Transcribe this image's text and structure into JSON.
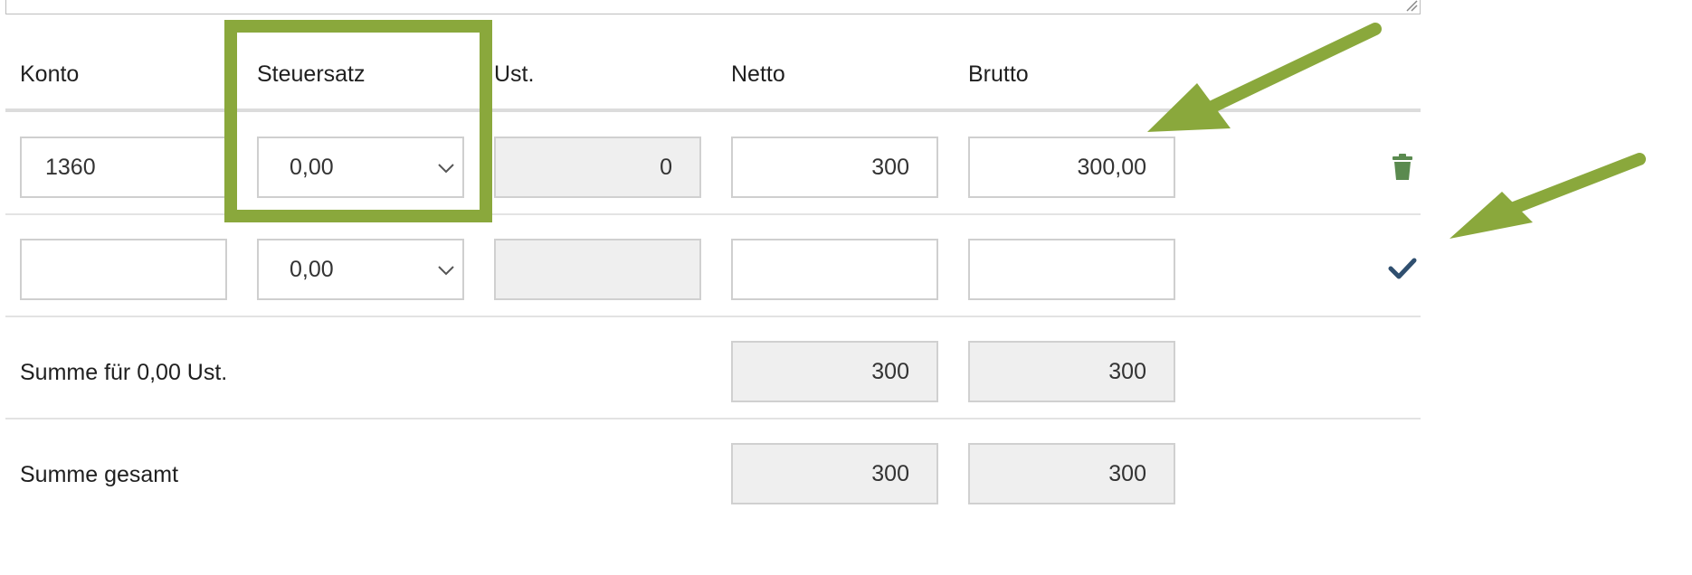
{
  "table": {
    "headers": {
      "konto": "Konto",
      "steuersatz": "Steuersatz",
      "ust": "Ust.",
      "netto": "Netto",
      "brutto": "Brutto"
    },
    "rows": [
      {
        "konto": "1360",
        "steuersatz": "0,00",
        "ust": "0",
        "netto": "300",
        "brutto": "300,00",
        "action_icon": "trash-icon"
      },
      {
        "konto": "",
        "steuersatz": "0,00",
        "ust": "",
        "netto": "",
        "brutto": "",
        "action_icon": "check-icon"
      }
    ],
    "summaries": [
      {
        "label": "Summe für 0,00 Ust.",
        "netto": "300",
        "brutto": "300"
      },
      {
        "label": "Summe gesamt",
        "netto": "300",
        "brutto": "300"
      }
    ]
  },
  "annotations": {
    "highlight_color": "#8aa83c",
    "arrow_color": "#8aa83c"
  },
  "colors": {
    "trash_icon": "#5a8a4f",
    "check_icon": "#2f4f6f",
    "readonly_bg": "#efefef"
  }
}
